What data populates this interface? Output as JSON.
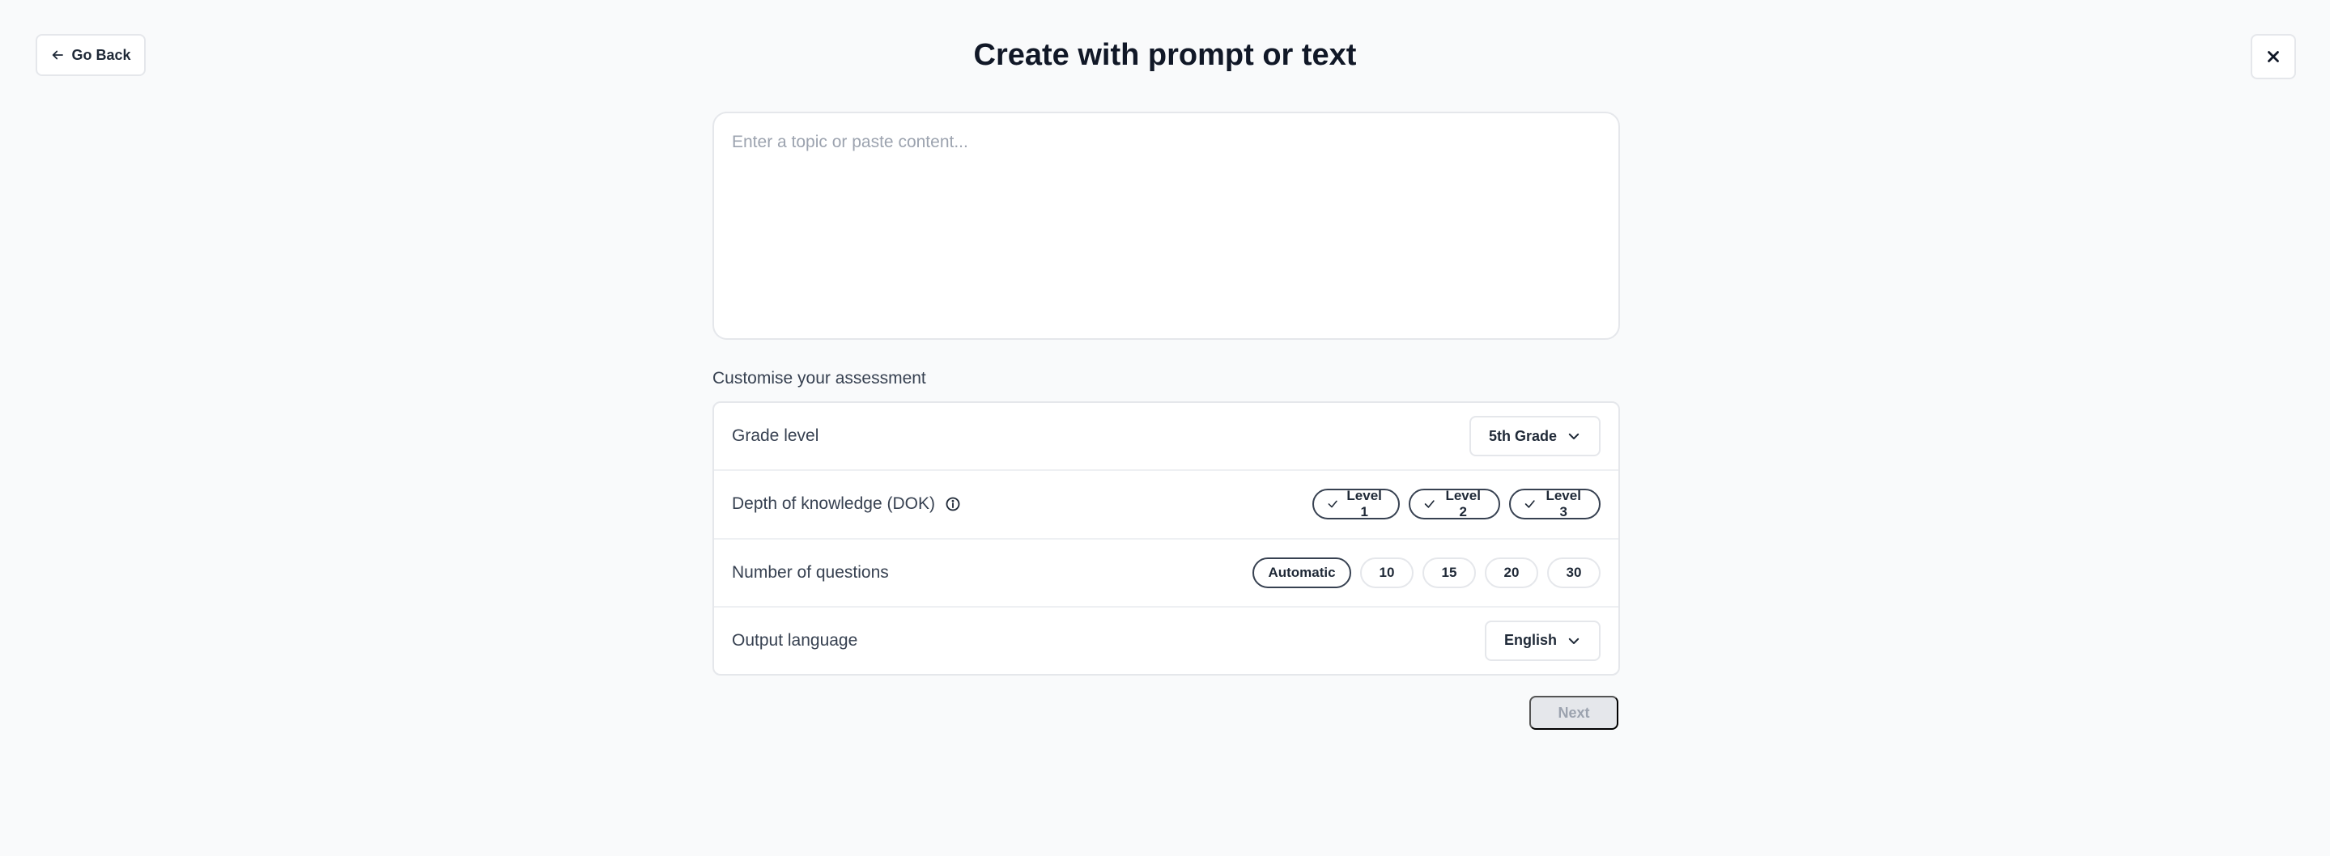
{
  "header": {
    "go_back_label": "Go Back",
    "title": "Create with prompt or text",
    "close_icon": "close-icon"
  },
  "prompt": {
    "value": "",
    "placeholder": "Enter a topic or paste content..."
  },
  "customise": {
    "section_label": "Customise your assessment",
    "grade": {
      "label": "Grade level",
      "selected": "5th Grade"
    },
    "dok": {
      "label": "Depth of knowledge (DOK)",
      "info_icon": "info-icon",
      "levels": [
        {
          "label": "Level 1",
          "checked": true
        },
        {
          "label": "Level 2",
          "checked": true
        },
        {
          "label": "Level 3",
          "checked": true
        }
      ]
    },
    "questions": {
      "label": "Number of questions",
      "options": [
        "Automatic",
        "10",
        "15",
        "20",
        "30"
      ],
      "selected": "Automatic"
    },
    "language": {
      "label": "Output language",
      "selected": "English"
    }
  },
  "footer": {
    "next_label": "Next",
    "next_disabled": true
  },
  "colors": {
    "background": "#f9fafb",
    "border": "#e5e7eb",
    "selected_border": "#374151",
    "disabled_button": "#e5e7eb"
  }
}
